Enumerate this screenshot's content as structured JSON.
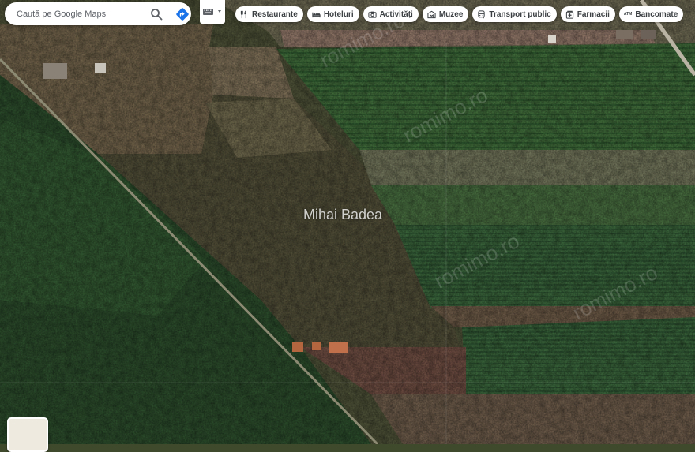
{
  "search": {
    "placeholder": "Caută pe Google Maps"
  },
  "categories": [
    {
      "label": "Restaurante",
      "icon": "cutlery-icon"
    },
    {
      "label": "Hoteluri",
      "icon": "bed-icon"
    },
    {
      "label": "Activități",
      "icon": "camera-icon"
    },
    {
      "label": "Muzee",
      "icon": "museum-icon"
    },
    {
      "label": "Transport public",
      "icon": "train-icon"
    },
    {
      "label": "Farmacii",
      "icon": "pharmacy-icon"
    },
    {
      "label": "Bancomate",
      "icon": "atm-icon",
      "glyph": "ATM"
    }
  ],
  "map": {
    "place_label": "Mihai Badea",
    "watermark": "romimo.ro",
    "view": "satellite"
  },
  "colors": {
    "chip_text": "#3c4043",
    "directions_blue": "#1a73e8",
    "directions_bg": "#00796b"
  }
}
